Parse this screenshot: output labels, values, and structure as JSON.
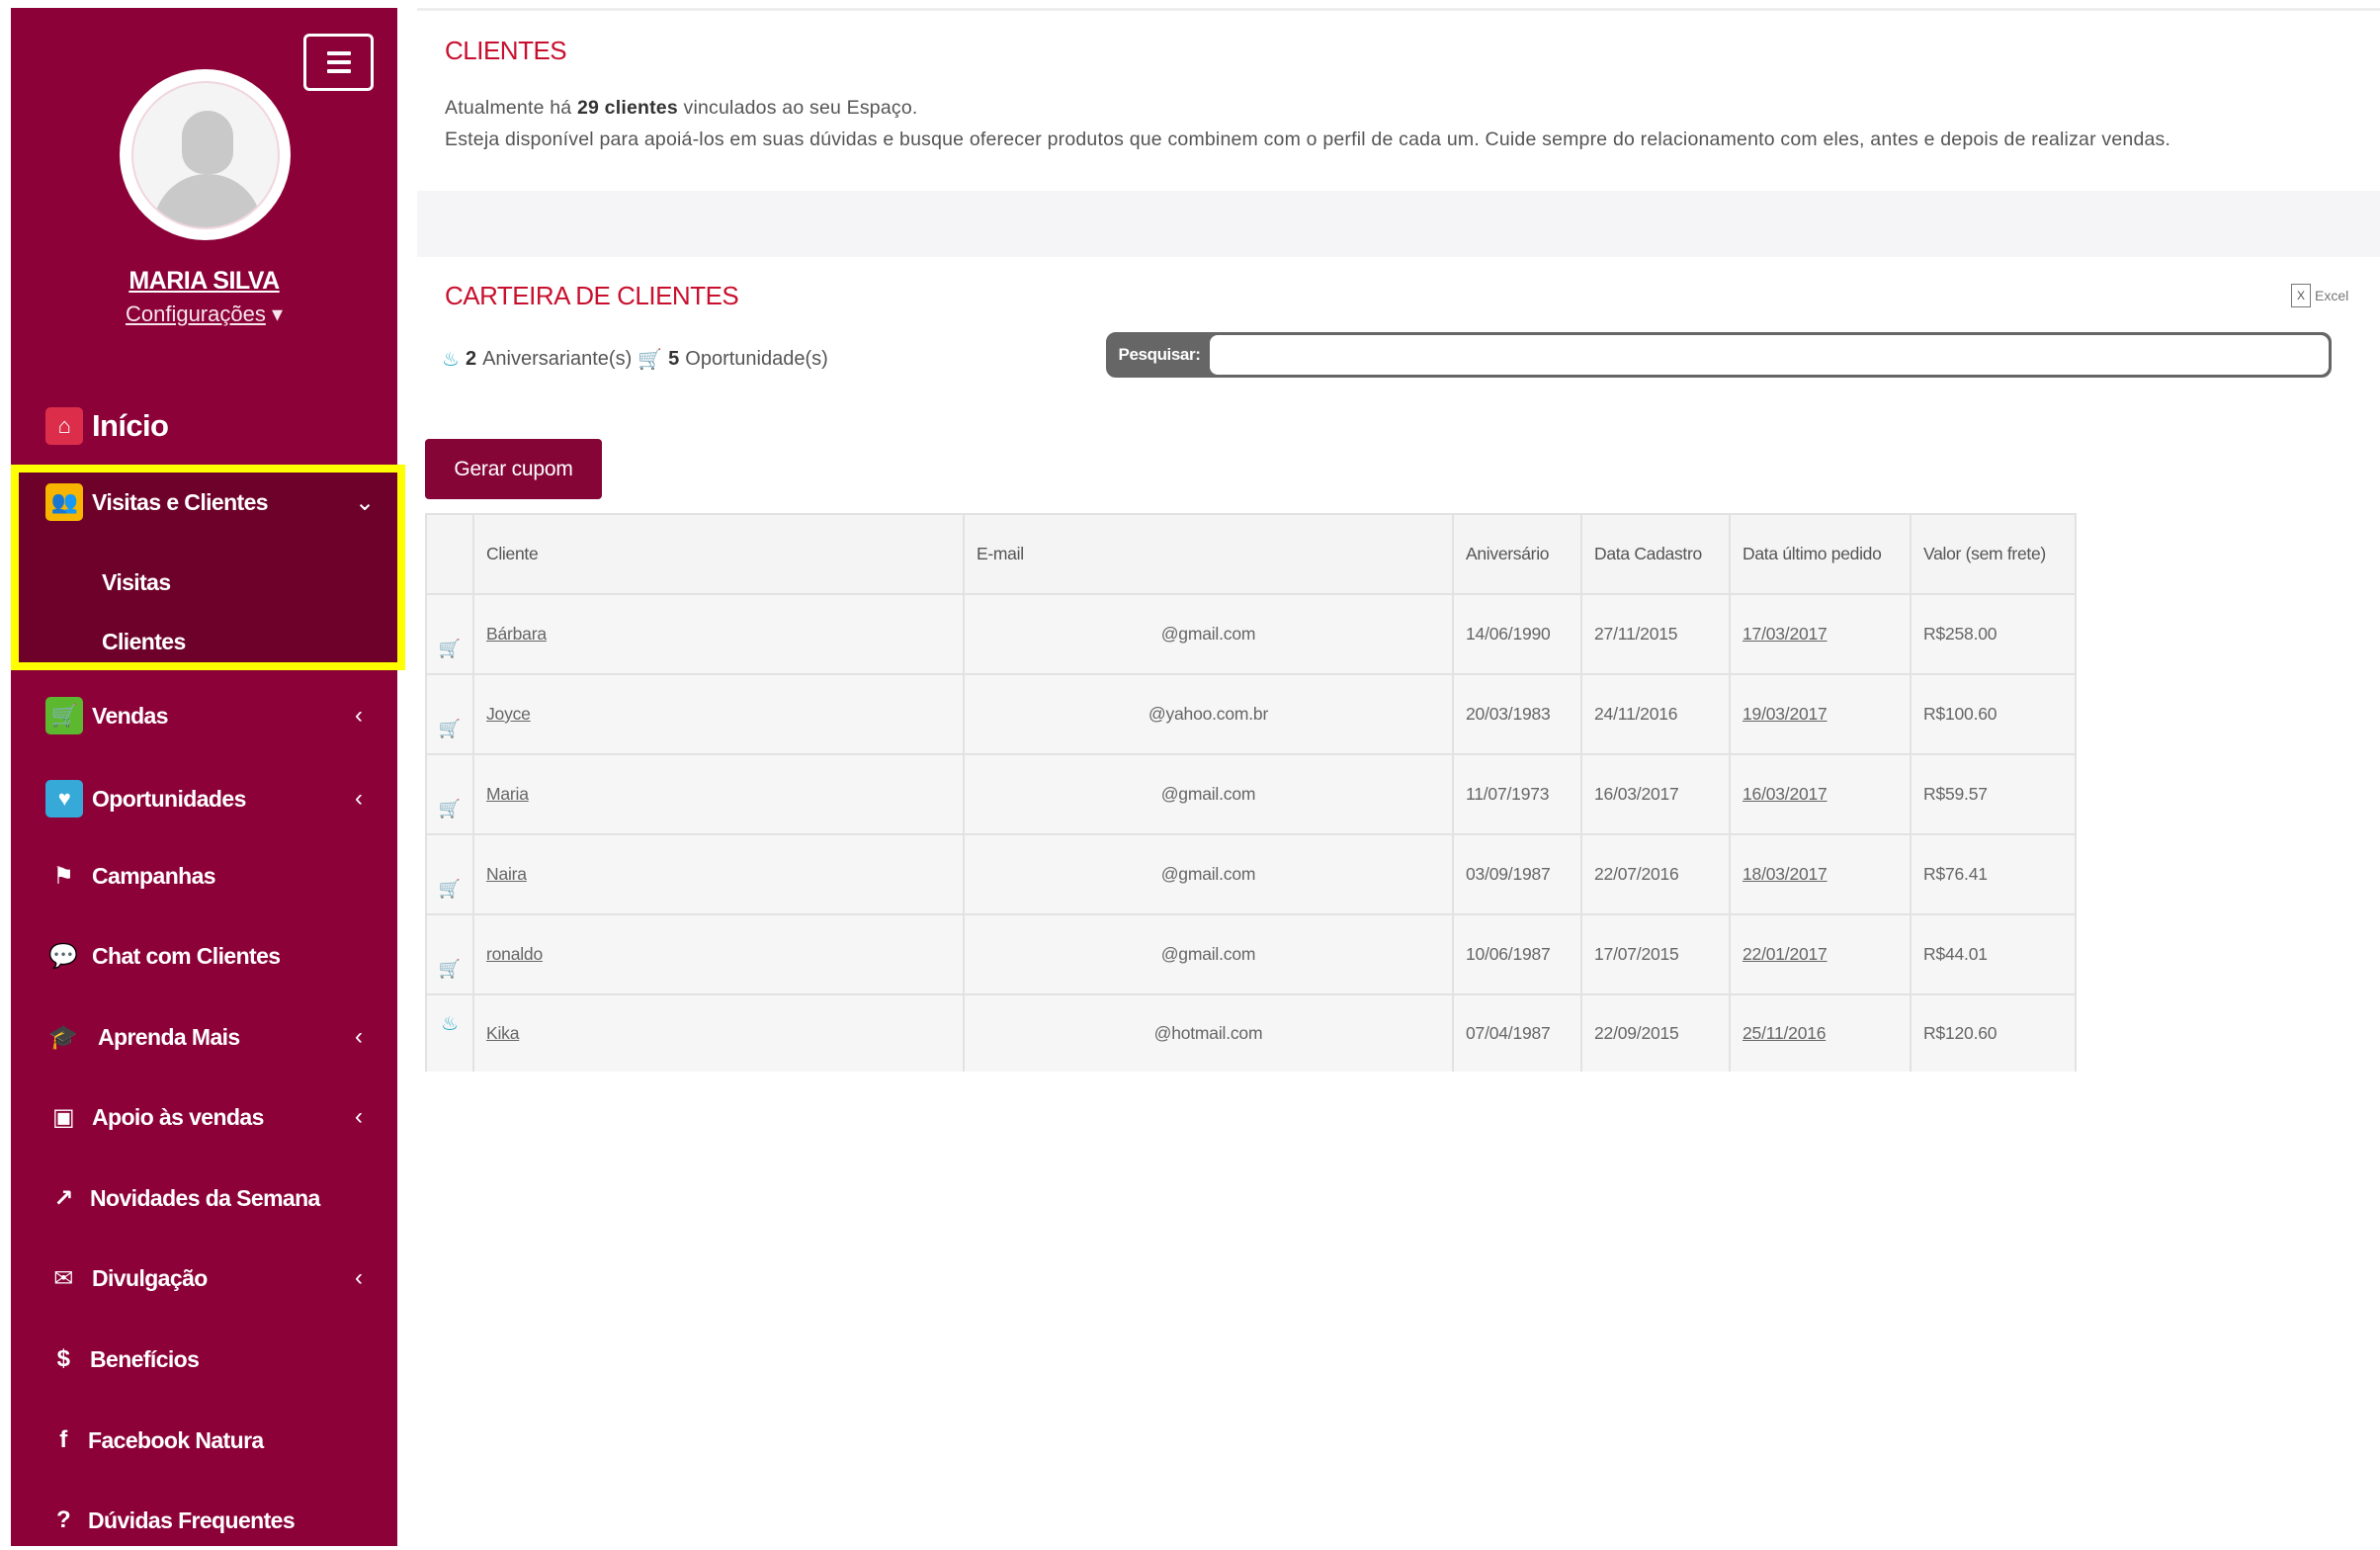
{
  "sidebar": {
    "user_name": "MARIA SILVA",
    "config_label": "Configurações",
    "home_label": "Início",
    "items": [
      {
        "label": "Visitas e Clientes",
        "icon": "users-icon",
        "icon_bg": "#f7b500",
        "chevron": "⌄"
      },
      {
        "label": "Vendas",
        "icon": "cart-icon",
        "icon_bg": "#5cb82f",
        "chevron": "‹"
      },
      {
        "label": "Oportunidades",
        "icon": "heart-icon",
        "icon_bg": "#36a9d8",
        "chevron": "‹"
      },
      {
        "label": "Campanhas",
        "icon": "flag-icon"
      },
      {
        "label": "Chat com Clientes",
        "icon": "chat-icon"
      },
      {
        "label": "Aprenda Mais",
        "icon": "graduation-cap-icon",
        "chevron": "‹"
      },
      {
        "label": "Apoio às vendas",
        "icon": "image-icon",
        "chevron": "‹"
      },
      {
        "label": "Novidades da Semana",
        "icon": "share-icon"
      },
      {
        "label": "Divulgação",
        "icon": "envelope-icon",
        "chevron": "‹"
      },
      {
        "label": "Benefícios",
        "icon": "dollar-icon"
      },
      {
        "label": "Facebook Natura",
        "icon": "facebook-icon"
      },
      {
        "label": "Dúvidas Frequentes",
        "icon": "question-icon"
      }
    ],
    "subitems": [
      "Visitas",
      "Clientes"
    ],
    "bg_color": "#8b0138",
    "highlight_color": "#ffff00"
  },
  "clientes": {
    "title": "CLIENTES",
    "line1_pre": "Atualmente há ",
    "line1_count": "29 clientes",
    "line1_post": " vinculados ao seu Espaço.",
    "line2": "Esteja disponível para apoiá-los em suas dúvidas e busque oferecer produtos que combinem com o perfil de cada um. Cuide sempre do relacionamento com eles, antes e depois de realizar vendas."
  },
  "carteira": {
    "title": "CARTEIRA DE CLIENTES",
    "excel_label": "Excel",
    "birthdays_count": "2",
    "birthdays_label": "Aniversariante(s)",
    "opportunities_count": "5",
    "opportunities_label": "Oportunidade(s)",
    "search_label": "Pesquisar:",
    "search_value": "",
    "coupon_button": "Gerar cupom"
  },
  "table": {
    "headers": [
      "Cliente",
      "E-mail",
      "Aniversário",
      "Data Cadastro",
      "Data último pedido",
      "Valor (sem frete)"
    ],
    "rows": [
      {
        "icon": "cart-icon",
        "cliente": "Bárbara",
        "email": "@gmail.com",
        "aniversario": "14/06/1990",
        "cadastro": "27/11/2015",
        "ultimo_pedido": "17/03/2017",
        "valor": "R$258.00"
      },
      {
        "icon": "cart-icon",
        "cliente": "Joyce",
        "email": "@yahoo.com.br",
        "aniversario": "20/03/1983",
        "cadastro": "24/11/2016",
        "ultimo_pedido": "19/03/2017",
        "valor": "R$100.60"
      },
      {
        "icon": "cart-icon",
        "cliente": "Maria",
        "email": "@gmail.com",
        "aniversario": "11/07/1973",
        "cadastro": "16/03/2017",
        "ultimo_pedido": "16/03/2017",
        "valor": "R$59.57"
      },
      {
        "icon": "cart-icon",
        "cliente": "Naira",
        "email": "@gmail.com",
        "aniversario": "03/09/1987",
        "cadastro": "22/07/2016",
        "ultimo_pedido": "18/03/2017",
        "valor": "R$76.41"
      },
      {
        "icon": "cart-icon",
        "cliente": "ronaldo",
        "email": "@gmail.com",
        "aniversario": "10/06/1987",
        "cadastro": "17/07/2015",
        "ultimo_pedido": "22/01/2017",
        "valor": "R$44.01"
      },
      {
        "icon": "birthday-cake-icon",
        "cliente": "Kika",
        "email": "@hotmail.com",
        "aniversario": "07/04/1987",
        "cadastro": "22/09/2015",
        "ultimo_pedido": "25/11/2016",
        "valor": "R$120.60"
      }
    ]
  },
  "colors": {
    "accent_red": "#c8102e",
    "button_bg": "#850537",
    "cart_orange": "#f58a0a",
    "cake_blue": "#2aa8c6"
  }
}
